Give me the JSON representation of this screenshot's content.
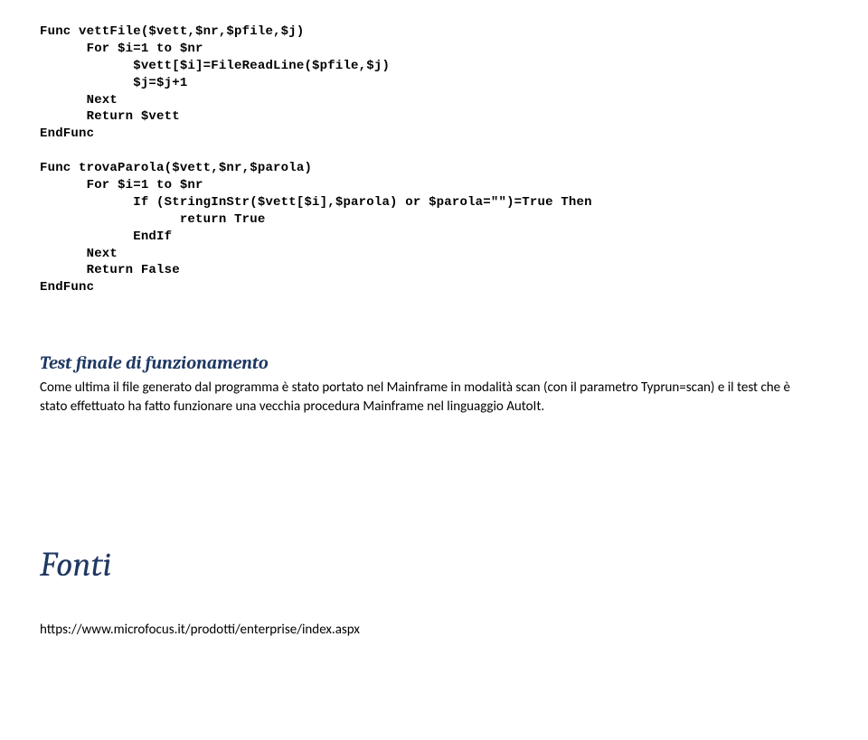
{
  "code": "Func vettFile($vett,$nr,$pfile,$j)\n      For $i=1 to $nr\n            $vett[$i]=FileReadLine($pfile,$j)\n            $j=$j+1\n      Next\n      Return $vett\nEndFunc\n\nFunc trovaParola($vett,$nr,$parola)\n      For $i=1 to $nr\n            If (StringInStr($vett[$i],$parola) or $parola=\"\")=True Then\n                  return True\n            EndIf\n      Next\n      Return False\nEndFunc",
  "section_title": "Test finale di funzionamento",
  "body_paragraph": "Come ultima il file generato dal programma è stato portato nel Mainframe in modalità scan (con il parametro Typrun=scan) e il test che è stato effettuato ha fatto funzionare una vecchia procedura Mainframe nel linguaggio AutoIt.",
  "big_title": "Fonti",
  "link": "https://www.microfocus.it/prodotti/enterprise/index.aspx"
}
